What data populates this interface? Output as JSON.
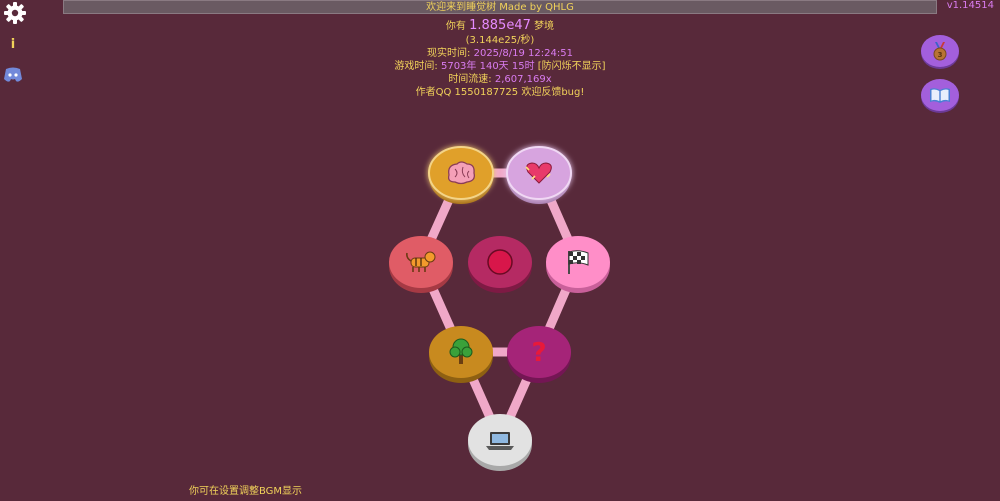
{
  "header": {
    "banner": "欢迎来到睡觉树 Made by QHLG",
    "version": "v1.14514"
  },
  "stats": {
    "points_prefix": "你有",
    "points_value": "1.885e47",
    "points_unit": "梦境",
    "per_second": "(3.144e25/秒)",
    "real_time_label": "现实时间:",
    "real_time_value": "2025/8/19 12:24:51",
    "game_time_label": "游戏时间:",
    "game_time_value": "5703年 140天 15时",
    "game_time_suffix": "[防闪烁不显示]",
    "speed_label": "时间流速:",
    "speed_value": "2,607,169x",
    "author": "作者QQ 1550187725 欢迎反馈bug!"
  },
  "footer": {
    "hint": "你可在设置调整BGM显示"
  },
  "icons": {
    "settings": "gear-icon",
    "info": "info-icon",
    "discord": "discord-icon",
    "achievements": "medal-icon",
    "journal": "book-icon"
  },
  "info_glyph": "i",
  "nodes": [
    {
      "id": "brain",
      "icon": "brain-icon",
      "color": "#e0a02c",
      "glow": true
    },
    {
      "id": "heart",
      "icon": "heart-icon",
      "color": "#d7a4df",
      "glow": true
    },
    {
      "id": "tiger",
      "icon": "tiger-icon",
      "color": "#e05c66"
    },
    {
      "id": "core",
      "icon": "circle-icon",
      "color": "#b52a63"
    },
    {
      "id": "flag",
      "icon": "checkered-flag-icon",
      "color": "#ff8ec8"
    },
    {
      "id": "tree",
      "icon": "tree-icon",
      "color": "#c88a1f"
    },
    {
      "id": "mystery",
      "icon": "question-mark-icon",
      "glyph": "?",
      "color": "#a52478"
    },
    {
      "id": "laptop",
      "icon": "laptop-icon",
      "color": "#e2e2e2"
    }
  ]
}
